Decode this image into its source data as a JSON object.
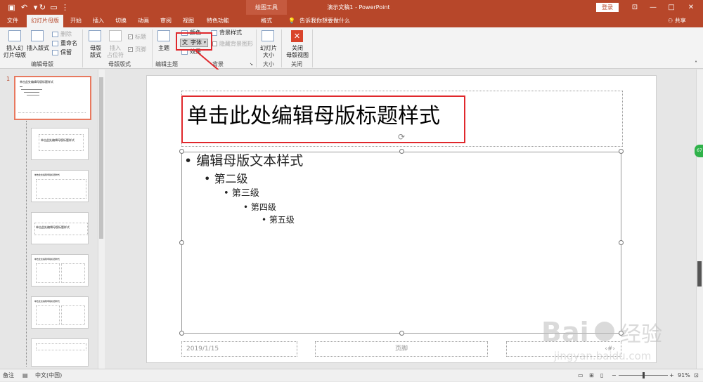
{
  "titlebar": {
    "contextual_group": "绘图工具",
    "document_title": "演示文稿1  -  PowerPoint",
    "login_label": "登录",
    "window_controls": [
      "—",
      "□",
      "✕"
    ],
    "quick_access": [
      "save-icon",
      "undo-icon",
      "redo-icon",
      "present-icon",
      "more-icon"
    ]
  },
  "tabs": [
    {
      "label": "文件"
    },
    {
      "label": "幻灯片母版",
      "active": true
    },
    {
      "label": "开始"
    },
    {
      "label": "插入"
    },
    {
      "label": "切换"
    },
    {
      "label": "动画"
    },
    {
      "label": "审阅"
    },
    {
      "label": "视图"
    },
    {
      "label": "特色功能"
    },
    {
      "label": "格式"
    }
  ],
  "tellme": "告诉我你想要做什么",
  "share_label": "共享",
  "ribbon": {
    "edit_master": {
      "insert_slide_master": "插入幻\n灯片母版",
      "insert_layout": "插入版式",
      "delete": "删除",
      "rename": "重命名",
      "preserve": "保留",
      "group_label": "编辑母版"
    },
    "master_layout": {
      "master_layout_btn": "母版\n版式",
      "insert_placeholder": "插入\n占位符",
      "title_check": "标题",
      "footer_check": "页脚",
      "group_label": "母版版式"
    },
    "edit_theme": {
      "themes": "主题",
      "colors": "颜色",
      "fonts": "字体",
      "effects": "效果",
      "group_label": "编辑主题"
    },
    "background": {
      "background_styles": "背景样式",
      "hide_background": "隐藏背景图形",
      "group_label": "背景"
    },
    "size": {
      "slide_size": "幻灯片\n大小",
      "group_label": "大小"
    },
    "close": {
      "close_master": "关闭\n母版视图",
      "group_label": "关闭"
    }
  },
  "thumbnails": {
    "master_index": "1",
    "master_title": "单击此处编辑母版标题样式",
    "layout_title": "单击此处编辑母版标题样式"
  },
  "slide": {
    "title": "单击此处编辑母版标题样式",
    "levels": [
      "编辑母版文本样式",
      "第二级",
      "第三级",
      "第四级",
      "第五级"
    ],
    "footer_date": "2019/1/15",
    "footer_text": "页脚",
    "footer_number": "‹#›"
  },
  "status": {
    "notes": "备注",
    "language": "中文(中国)",
    "zoom": "91%"
  },
  "side_badge": "67",
  "watermark": {
    "brand": "Bai",
    "brand2": "经验",
    "url": "jingyan.baidu.com"
  }
}
